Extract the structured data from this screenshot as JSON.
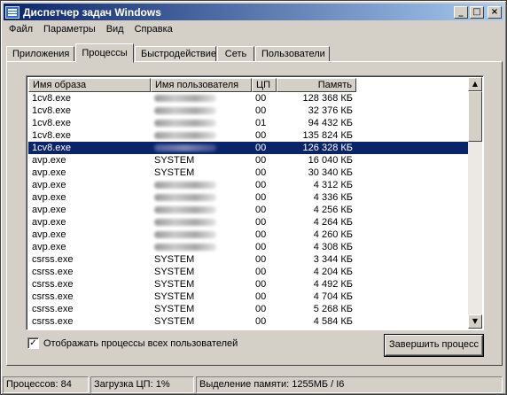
{
  "window": {
    "title": "Диспетчер задач Windows"
  },
  "titlebar_buttons": {
    "minimize": "_",
    "maximize": "□",
    "close": "×"
  },
  "menu": [
    {
      "label": "Файл"
    },
    {
      "label": "Параметры"
    },
    {
      "label": "Вид"
    },
    {
      "label": "Справка"
    }
  ],
  "tabs": [
    {
      "label": "Приложения"
    },
    {
      "label": "Процессы"
    },
    {
      "label": "Быстродействие"
    },
    {
      "label": "Сеть"
    },
    {
      "label": "Пользователи"
    }
  ],
  "active_tab": "Процессы",
  "columns": [
    "Имя образа",
    "Имя пользователя",
    "ЦП",
    "Память"
  ],
  "rows": [
    {
      "image": "1cv8.exe",
      "user": "",
      "user_obscured": true,
      "cpu": "00",
      "mem": "128 368 КБ"
    },
    {
      "image": "1cv8.exe",
      "user": "",
      "user_obscured": true,
      "cpu": "00",
      "mem": "32 376 КБ"
    },
    {
      "image": "1cv8.exe",
      "user": "",
      "user_obscured": true,
      "cpu": "01",
      "mem": "94 432 КБ"
    },
    {
      "image": "1cv8.exe",
      "user": "",
      "user_obscured": true,
      "cpu": "00",
      "mem": "135 824 КБ"
    },
    {
      "image": "1cv8.exe",
      "user": "",
      "user_obscured": true,
      "cpu": "00",
      "mem": "126 328 КБ",
      "selected": true
    },
    {
      "image": "avp.exe",
      "user": "SYSTEM",
      "cpu": "00",
      "mem": "16 040 КБ"
    },
    {
      "image": "avp.exe",
      "user": "SYSTEM",
      "cpu": "00",
      "mem": "30 340 КБ"
    },
    {
      "image": "avp.exe",
      "user": "",
      "user_obscured": true,
      "cpu": "00",
      "mem": "4 312 КБ"
    },
    {
      "image": "avp.exe",
      "user": "",
      "user_obscured": true,
      "cpu": "00",
      "mem": "4 336 КБ"
    },
    {
      "image": "avp.exe",
      "user": "",
      "user_obscured": true,
      "cpu": "00",
      "mem": "4 256 КБ"
    },
    {
      "image": "avp.exe",
      "user": "",
      "user_obscured": true,
      "cpu": "00",
      "mem": "4 264 КБ"
    },
    {
      "image": "avp.exe",
      "user": "",
      "user_obscured": true,
      "cpu": "00",
      "mem": "4 260 КБ"
    },
    {
      "image": "avp.exe",
      "user": "",
      "user_obscured": true,
      "cpu": "00",
      "mem": "4 308 КБ"
    },
    {
      "image": "csrss.exe",
      "user": "SYSTEM",
      "cpu": "00",
      "mem": "3 344 КБ"
    },
    {
      "image": "csrss.exe",
      "user": "SYSTEM",
      "cpu": "00",
      "mem": "4 204 КБ"
    },
    {
      "image": "csrss.exe",
      "user": "SYSTEM",
      "cpu": "00",
      "mem": "4 492 КБ"
    },
    {
      "image": "csrss.exe",
      "user": "SYSTEM",
      "cpu": "00",
      "mem": "4 704 КБ"
    },
    {
      "image": "csrss.exe",
      "user": "SYSTEM",
      "cpu": "00",
      "mem": "5 268 КБ"
    },
    {
      "image": "csrss.exe",
      "user": "SYSTEM",
      "cpu": "00",
      "mem": "4 584 КБ"
    }
  ],
  "show_all_users": {
    "label": "Отображать процессы всех пользователей",
    "checked": true,
    "mark": "✓"
  },
  "end_process_button": "Завершить процесс",
  "scrollbar": {
    "up": "▲",
    "down": "▼"
  },
  "statusbar": {
    "processes": "Процессов: 84",
    "cpu": "Загрузка ЦП: 1%",
    "memory": "Выделение памяти: 1255МБ / I6"
  }
}
